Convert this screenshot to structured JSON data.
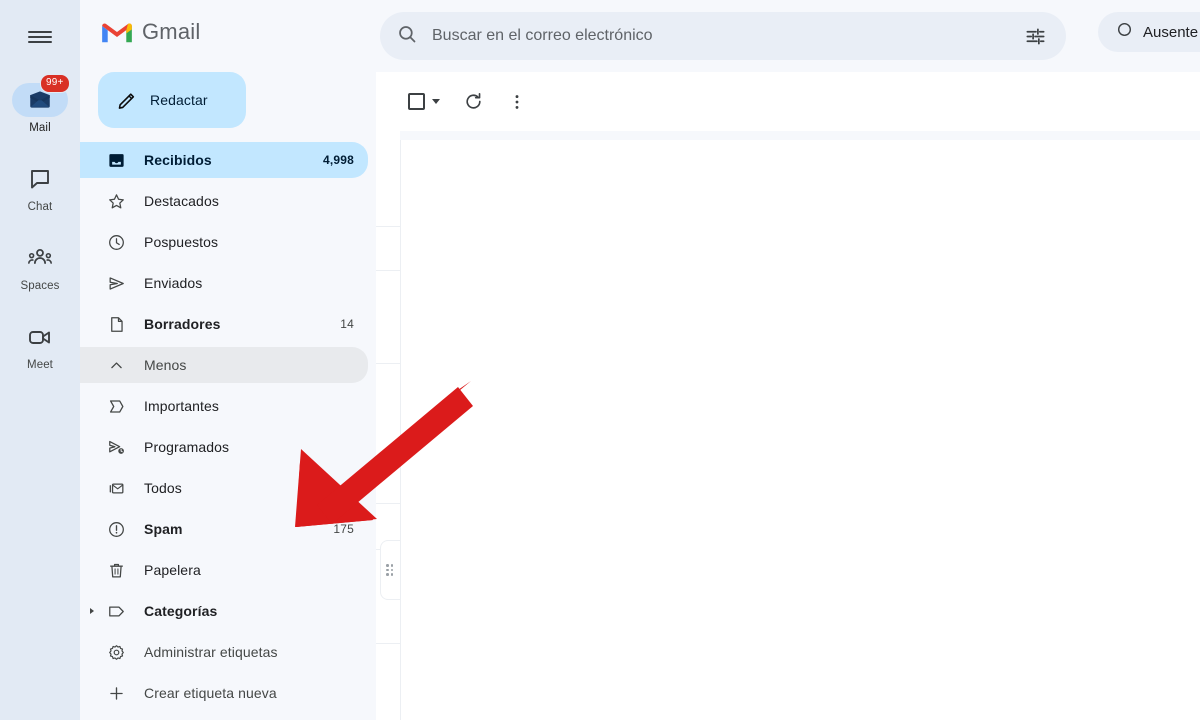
{
  "app": {
    "name": "Gmail",
    "logo_icon": "gmail-m-logo-icon",
    "hamburger_icon": "hamburger-menu-icon"
  },
  "rail": {
    "items": [
      {
        "label": "Mail",
        "icon": "mail-inbox-icon",
        "badge": "99+",
        "active": true
      },
      {
        "label": "Chat",
        "icon": "chat-bubble-icon",
        "badge": "",
        "active": false
      },
      {
        "label": "Spaces",
        "icon": "spaces-people-icon",
        "badge": "",
        "active": false
      },
      {
        "label": "Meet",
        "icon": "meet-video-camera-icon",
        "badge": "",
        "active": false
      }
    ]
  },
  "sidebar": {
    "compose": {
      "label": "Redactar",
      "icon": "pencil-compose-icon"
    },
    "nav": [
      {
        "label": "Recibidos",
        "count": "4,998",
        "icon": "inbox-icon",
        "state": "selected"
      },
      {
        "label": "Destacados",
        "count": "",
        "icon": "star-icon",
        "state": "normal"
      },
      {
        "label": "Pospuestos",
        "count": "",
        "icon": "clock-snooze-icon",
        "state": "normal"
      },
      {
        "label": "Enviados",
        "count": "",
        "icon": "send-paper-plane-icon",
        "state": "normal"
      },
      {
        "label": "Borradores",
        "count": "14",
        "icon": "draft-document-icon",
        "state": "bold"
      },
      {
        "label": "Menos",
        "count": "",
        "icon": "chevron-up-icon",
        "state": "toggle"
      },
      {
        "label": "Importantes",
        "count": "",
        "icon": "important-chevron-icon",
        "state": "normal"
      },
      {
        "label": "Programados",
        "count": "",
        "icon": "scheduled-send-icon",
        "state": "normal"
      },
      {
        "label": "Todos",
        "count": "",
        "icon": "all-mail-archive-icon",
        "state": "normal"
      },
      {
        "label": "Spam",
        "count": "175",
        "icon": "spam-alert-icon",
        "state": "bold"
      },
      {
        "label": "Papelera",
        "count": "",
        "icon": "trash-icon",
        "state": "normal"
      },
      {
        "label": "Categorías",
        "count": "",
        "icon": "label-tag-icon",
        "state": "expandable"
      },
      {
        "label": "Administrar etiquetas",
        "count": "",
        "icon": "settings-gear-icon",
        "state": "muted"
      },
      {
        "label": "Crear etiqueta nueva",
        "count": "",
        "icon": "plus-icon",
        "state": "muted"
      }
    ]
  },
  "search": {
    "placeholder": "Buscar en el correo electrónico",
    "value": "",
    "search_icon": "search-magnifier-icon",
    "filter_icon": "search-options-filter-icon"
  },
  "status": {
    "label": "Ausente",
    "icon": "status-away-circle-icon"
  },
  "toolbar": {
    "select_all_label": "",
    "select_all_icon": "select-all-checkbox-icon",
    "select_caret_icon": "chevron-down-icon",
    "refresh_icon": "refresh-icon",
    "more_icon": "more-vertical-kebab-icon"
  },
  "annotation": {
    "arrow_color": "#DB1B1B",
    "arrow_points_to": "Spam"
  },
  "colors": {
    "rail_bg": "#E2EAF4",
    "sidebar_bg": "#F6F8FC",
    "selected_bg": "#C2E7FF",
    "compose_bg": "#C2E7FF",
    "badge_red": "#D93025",
    "search_bg": "#E9EEF6",
    "content_bg": "#FFFFFF"
  }
}
